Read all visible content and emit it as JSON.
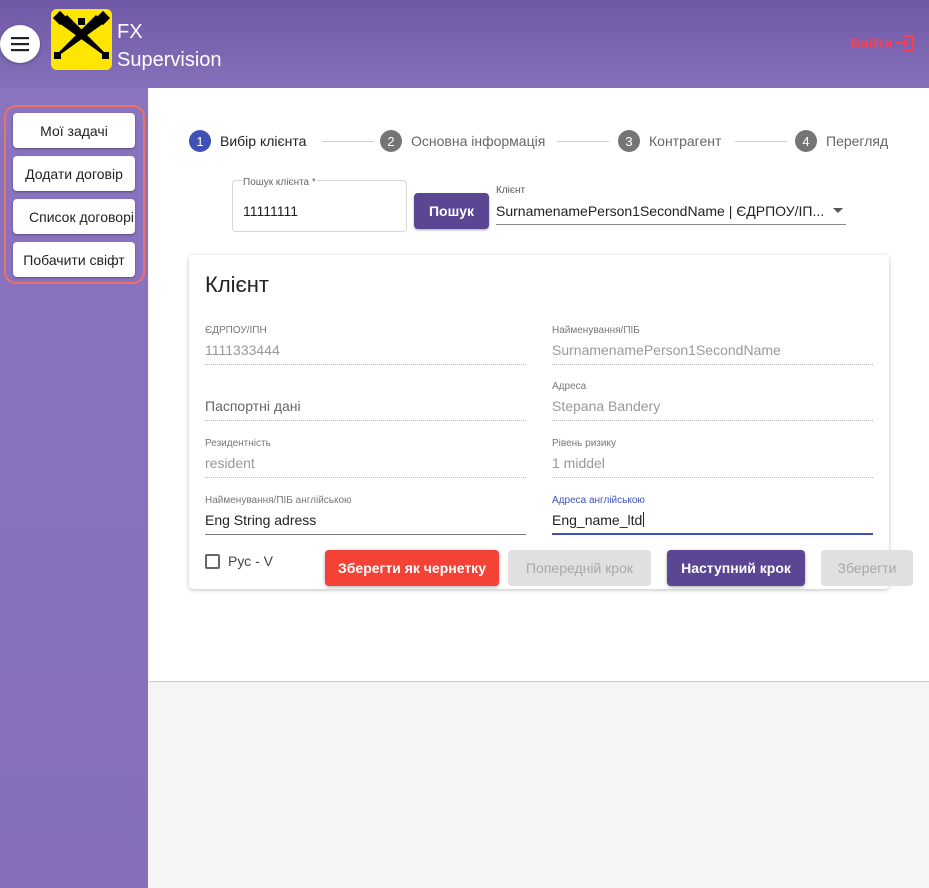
{
  "header": {
    "brand_line1": "FX",
    "brand_line2": "Supervision",
    "logout_label": "Вийти",
    "accent_color": "#ff3d4f",
    "logo_color": "#fee600"
  },
  "sidebar": {
    "items": [
      {
        "label": "Мої задачі"
      },
      {
        "label": "Додати договір"
      },
      {
        "label": "Список договорів"
      },
      {
        "label": "Побачити свіфт"
      }
    ]
  },
  "stepper": {
    "steps": [
      {
        "number": "1",
        "label": "Вибір клієнта",
        "active": true
      },
      {
        "number": "2",
        "label": "Основна інформація",
        "active": false
      },
      {
        "number": "3",
        "label": "Контрагент",
        "active": false
      },
      {
        "number": "4",
        "label": "Перегляд",
        "active": false
      }
    ]
  },
  "search": {
    "label": "Пошук клієнта *",
    "value": "11111111",
    "button_label": "Пошук",
    "client_label": "Клієнт",
    "client_value": "SurnamenamePerson1SecondName | ЄДРПОУ/ІП..."
  },
  "client_card": {
    "title": "Клієнт",
    "fields": {
      "edrpou": {
        "label": "ЄДРПОУ/ІПН",
        "value": "1111333444"
      },
      "name": {
        "label": "Найменування/ПІБ",
        "value": "SurnamenamePerson1SecondName"
      },
      "passport": {
        "label": "",
        "value": "Паспортні дані"
      },
      "address": {
        "label": "Адреса",
        "value": "Stepana Bandery"
      },
      "residency": {
        "label": "Резидентність",
        "value": "resident"
      },
      "risk": {
        "label": "Рівень ризику",
        "value": "1 middel"
      },
      "name_en": {
        "label": "Найменування/ПІБ англійською",
        "value": "Eng String adress"
      },
      "address_en": {
        "label": "Адреса англійською",
        "value": "Eng_name_ltd"
      }
    },
    "checkbox_label": "Рус - V"
  },
  "actions": {
    "save_draft": "Зберегти як чернетку",
    "previous": "Попередній крок",
    "next": "Наступний крок",
    "save": "Зберегти"
  }
}
